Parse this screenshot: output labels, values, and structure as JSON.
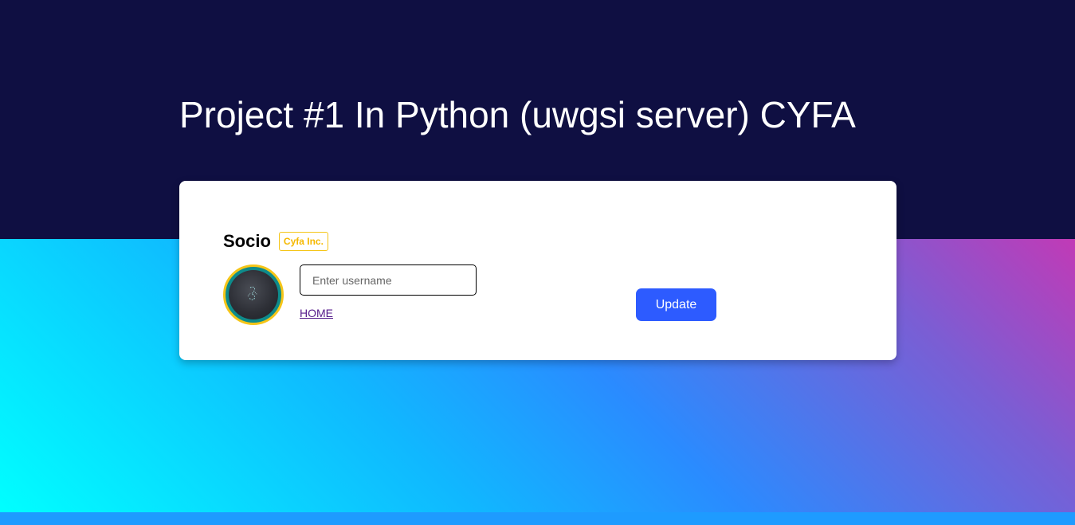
{
  "header": {
    "title": "Project #1 In Python (uwgsi server) CYFA"
  },
  "card": {
    "brand_name": "Socio",
    "brand_badge": "Cyfa Inc.",
    "avatar_icon": "profile-picture",
    "username": {
      "value": "",
      "placeholder": "Enter username"
    },
    "home_link_label": "HOME",
    "update_button_label": "Update"
  },
  "colors": {
    "header_background": "#0f0f42",
    "badge_accent": "#f5c518",
    "button_accent": "#2d5bff",
    "gradient_start": "#00ffff",
    "gradient_end": "#c13ab6"
  }
}
